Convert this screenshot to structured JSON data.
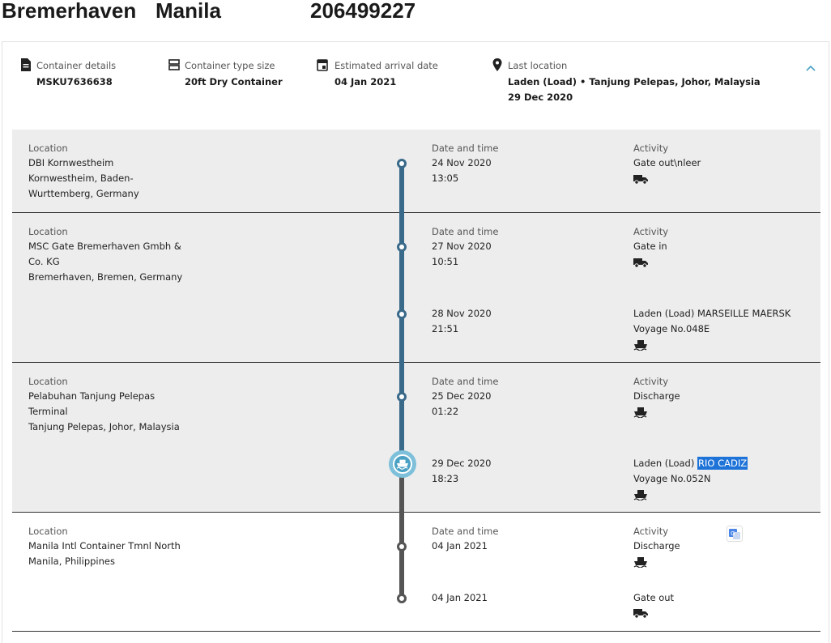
{
  "header": {
    "origin": "Bremerhaven",
    "destination": "Manila",
    "number": "206499227"
  },
  "summary": {
    "container_details_label": "Container details",
    "container_details_value": "MSKU7636638",
    "type_size_label": "Container type size",
    "type_size_value": "20ft Dry Container",
    "eta_label": "Estimated arrival date",
    "eta_value": "04 Jan 2021",
    "last_location_label": "Last location",
    "last_location_value": "Laden (Load) • Tanjung Pelepas, Johor, Malaysia",
    "last_location_date": "29 Dec 2020"
  },
  "labels": {
    "location": "Location",
    "date_time": "Date and time",
    "activity": "Activity"
  },
  "groups": [
    {
      "location_lines": [
        "DBI Kornwestheim",
        "Kornwestheim, Baden-",
        "Wurttemberg, Germany"
      ],
      "events": [
        {
          "date": "24 Nov 2020",
          "time": "13:05",
          "activity": "Gate out\\nleer",
          "icon": "truck-icon"
        }
      ]
    },
    {
      "location_lines": [
        "MSC Gate Bremerhaven Gmbh &",
        "Co. KG",
        "Bremerhaven, Bremen, Germany"
      ],
      "events": [
        {
          "date": "27 Nov 2020",
          "time": "10:51",
          "activity": "Gate in",
          "icon": "truck-icon"
        },
        {
          "date": "28 Nov 2020",
          "time": "21:51",
          "activity": "Laden (Load) MARSEILLE MAERSK",
          "voyage": "Voyage No.048E",
          "icon": "ship-icon"
        }
      ]
    },
    {
      "location_lines": [
        "Pelabuhan Tanjung Pelepas",
        "Terminal",
        "Tanjung Pelepas, Johor, Malaysia"
      ],
      "events": [
        {
          "date": "25 Dec 2020",
          "time": "01:22",
          "activity": "Discharge",
          "icon": "ship-icon"
        },
        {
          "date": "29 Dec 2020",
          "time": "18:23",
          "activity_prefix": "Laden (Load) ",
          "activity_highlight": "RIO CADIZ",
          "voyage": "Voyage No.052N",
          "icon": "ship-icon"
        }
      ]
    },
    {
      "location_lines": [
        "Manila Intl Container Tmnl North",
        "Manila, Philippines"
      ],
      "events": [
        {
          "date": "04 Jan 2021",
          "activity": "Discharge",
          "icon": "ship-icon"
        },
        {
          "date": "04 Jan 2021",
          "activity": "Gate out",
          "icon": "truck-icon"
        }
      ]
    }
  ],
  "colors": {
    "past_line": "#3a6a8a",
    "future_line": "#555555",
    "current_ring": "#7ec0da",
    "highlight": "#1e73d8"
  }
}
